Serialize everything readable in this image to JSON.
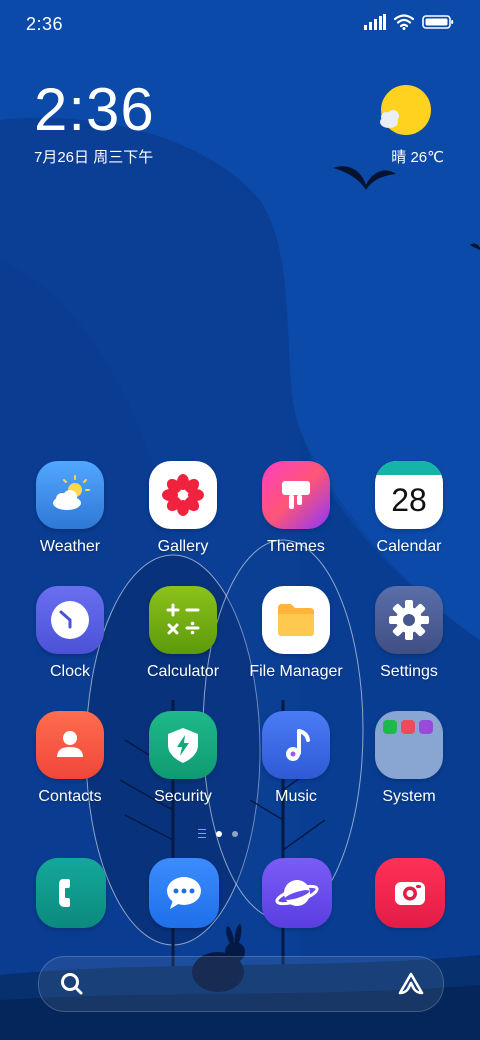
{
  "status_bar": {
    "time": "2:36"
  },
  "clock_widget": {
    "time": "2:36",
    "date": "7月26日 周三下午"
  },
  "weather_widget": {
    "text": "晴 26℃"
  },
  "apps": [
    {
      "name": "Weather",
      "icon": "weather-icon"
    },
    {
      "name": "Gallery",
      "icon": "gallery-icon"
    },
    {
      "name": "Themes",
      "icon": "themes-icon"
    },
    {
      "name": "Calendar",
      "icon": "calendar-icon",
      "badge": "28"
    },
    {
      "name": "Clock",
      "icon": "clock-icon"
    },
    {
      "name": "Calculator",
      "icon": "calculator-icon"
    },
    {
      "name": "File Manager",
      "icon": "file-manager-icon"
    },
    {
      "name": "Settings",
      "icon": "settings-icon"
    },
    {
      "name": "Contacts",
      "icon": "contacts-icon"
    },
    {
      "name": "Security",
      "icon": "security-icon"
    },
    {
      "name": "Music",
      "icon": "music-icon"
    },
    {
      "name": "System",
      "icon": "folder-icon"
    }
  ],
  "dock": [
    {
      "icon": "phone-icon"
    },
    {
      "icon": "messages-icon"
    },
    {
      "icon": "browser-icon"
    },
    {
      "icon": "camera-icon"
    }
  ],
  "search_bar": {
    "icon": "search-icon",
    "assistant_icon": "assistant-icon"
  },
  "colors": {
    "wallpaper_sky": "#0b4aa8",
    "wallpaper_hill": "#083f94",
    "weather_sun": "#ffd21f"
  }
}
